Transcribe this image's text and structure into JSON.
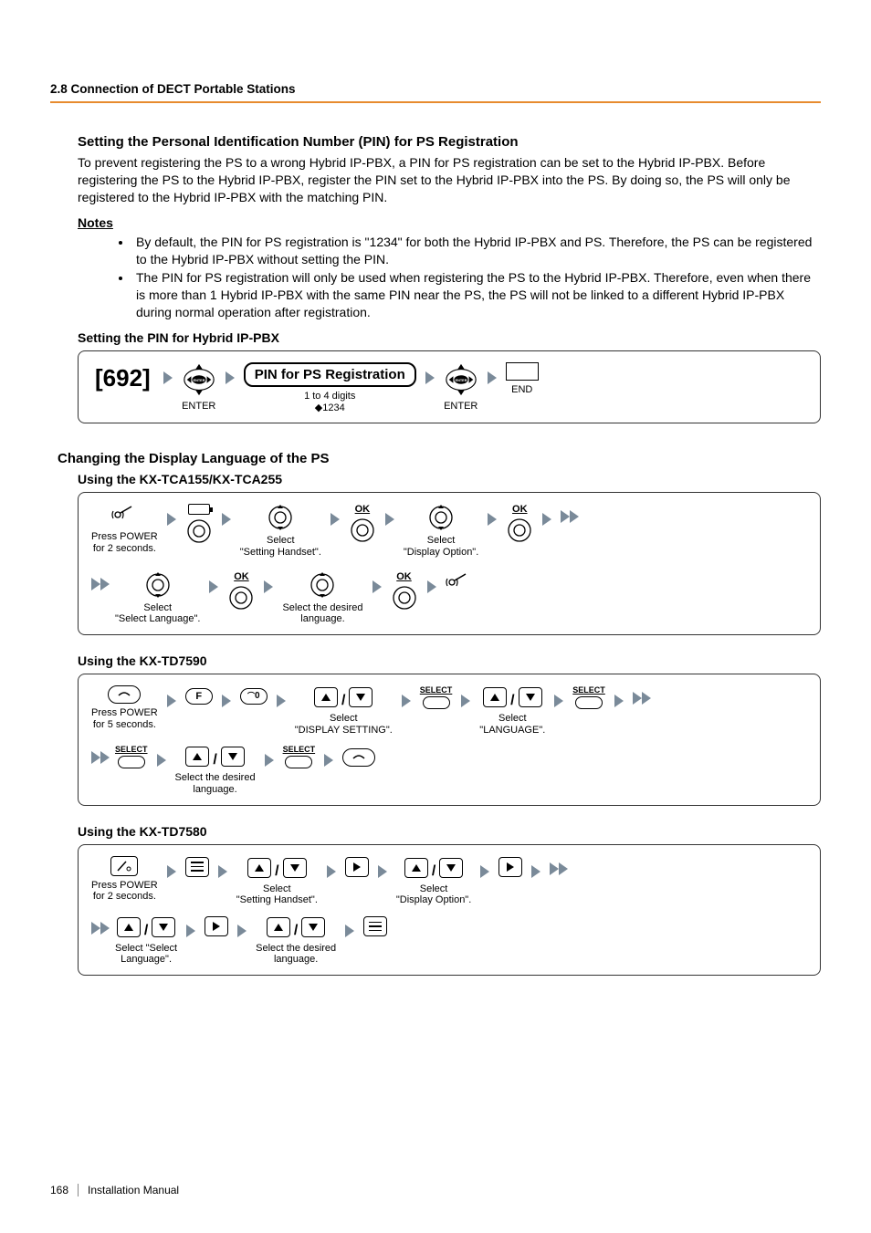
{
  "header": {
    "section": "2.8 Connection of DECT Portable Stations"
  },
  "pin_section": {
    "title": "Setting the Personal Identification Number (PIN) for PS Registration",
    "intro": "To prevent registering the PS to a wrong Hybrid IP-PBX, a PIN for PS registration can be set to the Hybrid IP-PBX. Before registering the PS to the Hybrid IP-PBX, register the PIN set to the Hybrid IP-PBX into the PS. By doing so, the PS will only be registered to the Hybrid IP-PBX with the matching PIN.",
    "notes_label": "Notes",
    "notes": [
      "By default, the PIN for PS registration is \"1234\" for both the Hybrid IP-PBX and PS. Therefore, the PS can be registered to the Hybrid IP-PBX without setting the PIN.",
      "The PIN for PS registration will only be used when registering the PS to the Hybrid IP-PBX. Therefore, even when there is more than 1 Hybrid IP-PBX with the same PIN near the PS, the PS will not be linked to a different Hybrid IP-PBX during normal operation after registration."
    ],
    "subheading": "Setting the PIN for Hybrid IP-PBX",
    "flow": {
      "code": "[692]",
      "enter1": "ENTER",
      "box_label": "PIN for PS Registration",
      "digits": "1 to 4 digits",
      "default": "◆1234",
      "enter2": "ENTER",
      "end": "END"
    }
  },
  "lang_section": {
    "title": "Changing the Display Language of the PS",
    "tca": {
      "heading": "Using the KX-TCA155/KX-TCA255",
      "step1": "Press POWER\nfor 2 seconds.",
      "step2": "Select\n\"Setting Handset\".",
      "ok": "OK",
      "step3": "Select\n\"Display Option\".",
      "step4": "Select\n\"Select Language\".",
      "step5": "Select the desired\nlanguage."
    },
    "td7590": {
      "heading": "Using the KX-TD7590",
      "step1": "Press POWER\nfor 5 seconds.",
      "select": "SELECT",
      "f": "F",
      "zero": "0",
      "step2": "Select\n\"DISPLAY SETTING\".",
      "step3": "Select\n\"LANGUAGE\".",
      "step4": "Select the desired\nlanguage."
    },
    "td7580": {
      "heading": "Using the KX-TD7580",
      "step1": "Press POWER\nfor 2 seconds.",
      "step2": "Select\n\"Setting Handset\".",
      "step3": "Select\n\"Display Option\".",
      "step4": "Select \"Select\nLanguage\".",
      "step5": "Select the desired\nlanguage."
    }
  },
  "footer": {
    "page": "168",
    "doc": "Installation Manual"
  }
}
